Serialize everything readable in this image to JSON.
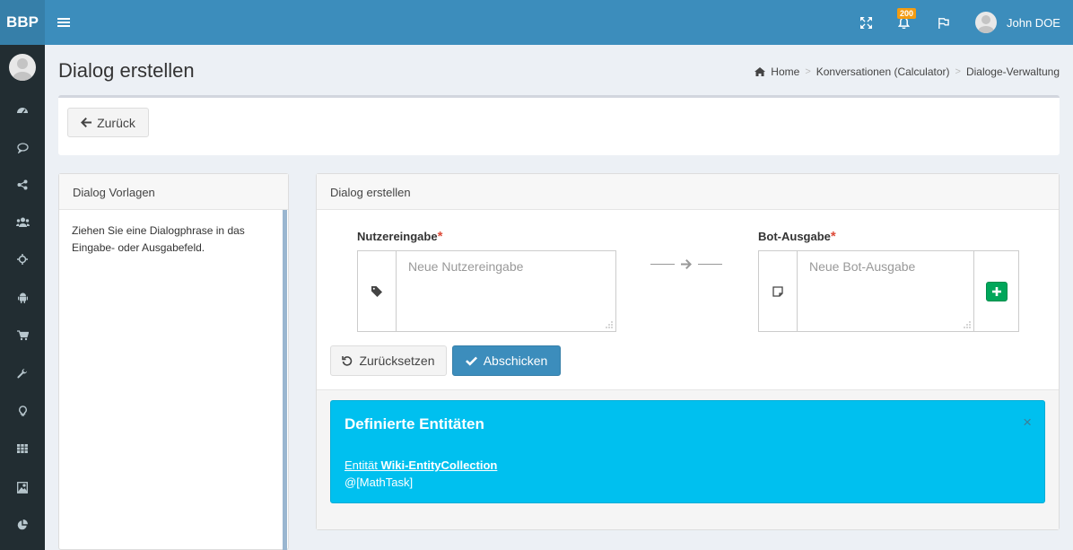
{
  "app": {
    "logo": "BBP"
  },
  "topbar": {
    "notification_count": "200",
    "user_name": "John DOE"
  },
  "sidebar": {
    "items": [
      {
        "icon": "dashboard-icon"
      },
      {
        "icon": "comment-icon"
      },
      {
        "icon": "share-icon"
      },
      {
        "icon": "users-icon"
      },
      {
        "icon": "crosshairs-icon"
      },
      {
        "icon": "android-icon"
      },
      {
        "icon": "cart-icon"
      },
      {
        "icon": "wrench-icon"
      },
      {
        "icon": "lightbulb-icon"
      },
      {
        "icon": "grid-icon"
      },
      {
        "icon": "image-icon"
      },
      {
        "icon": "pie-chart-icon"
      }
    ]
  },
  "page": {
    "title": "Dialog erstellen",
    "breadcrumb": [
      "Home",
      "Konversationen (Calculator)",
      "Dialoge-Verwaltung"
    ]
  },
  "back_button": {
    "label": "Zurück"
  },
  "templates_panel": {
    "title": "Dialog Vorlagen",
    "text": "Ziehen Sie eine Dialogphrase in das Eingabe- oder Ausgabefeld."
  },
  "dialog_panel": {
    "title": "Dialog erstellen",
    "user_input": {
      "label": "Nutzereingabe",
      "required_mark": "*",
      "placeholder": "Neue Nutzereingabe",
      "value": ""
    },
    "bot_output": {
      "label": "Bot-Ausgabe",
      "required_mark": "*",
      "placeholder": "Neue Bot-Ausgabe",
      "value": ""
    },
    "reset_label": "Zurücksetzen",
    "submit_label": "Abschicken"
  },
  "entities_callout": {
    "title": "Definierte Entitäten",
    "close_symbol": "×",
    "link_prefix": "Entität ",
    "link_name": "Wiki-EntityCollection",
    "reference": "@[MathTask]"
  },
  "colors": {
    "header": "#3c8dbc",
    "logo_bg": "#367fa9",
    "sidebar": "#222d32",
    "callout": "#00c0ef",
    "submit": "#3c8dbc",
    "add": "#00a65a",
    "badge": "#f39c12"
  }
}
